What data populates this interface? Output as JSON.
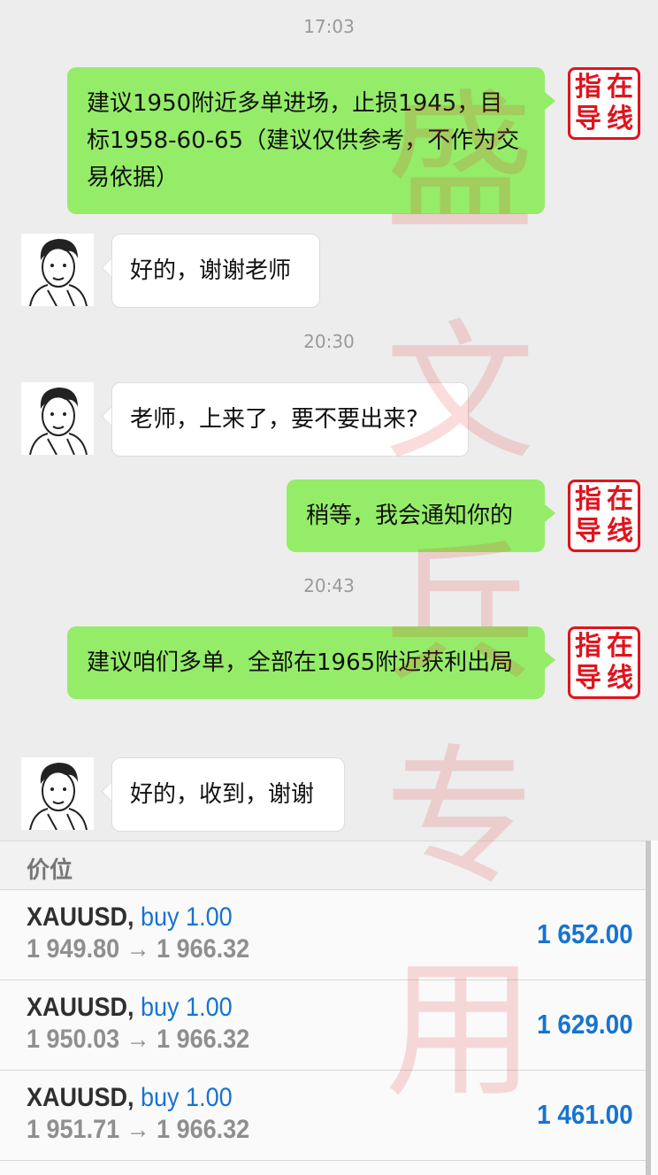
{
  "chat": {
    "times": [
      "17:03",
      "20:30",
      "20:43"
    ],
    "messages": [
      {
        "text": "建议1950附近多单进场，止损1945，目标1958-60-65（建议仅供参考，不作为交易依据）"
      },
      {
        "text": "好的，谢谢老师"
      },
      {
        "text": "老师，上来了，要不要出来?"
      },
      {
        "text": "稍等，我会通知你的"
      },
      {
        "text": "建议咱们多单，全部在1965附近获利出局"
      },
      {
        "text": "好的，收到，谢谢"
      }
    ],
    "stamp_chars": [
      "指",
      "在",
      "导",
      "线"
    ],
    "watermark": [
      "盛",
      "文",
      "兵",
      "专",
      "用"
    ]
  },
  "positions": {
    "header": "价位",
    "rows": [
      {
        "symbol": "XAUUSD,",
        "action": "buy 1.00",
        "prices": "1 949.80 → 1 966.32",
        "profit": "1 652.00"
      },
      {
        "symbol": "XAUUSD,",
        "action": "buy 1.00",
        "prices": "1 950.03 → 1 966.32",
        "profit": "1 629.00"
      },
      {
        "symbol": "XAUUSD,",
        "action": "buy 1.00",
        "prices": "1 951.71 → 1 966.32",
        "profit": "1 461.00"
      }
    ]
  },
  "colors": {
    "bubble_out": "#95ec69",
    "accent_blue": "#1673d1",
    "stamp_red": "#e0141e"
  }
}
